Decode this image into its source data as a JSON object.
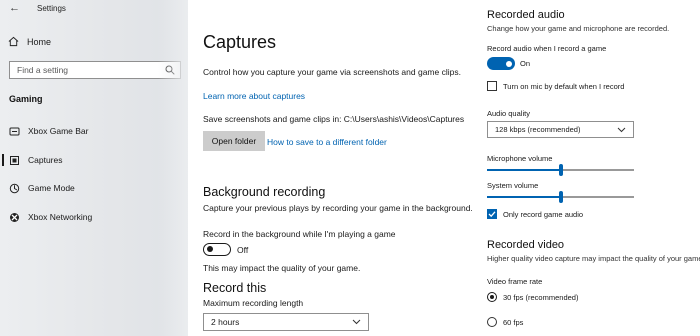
{
  "window": {
    "title": "Settings"
  },
  "sidebar": {
    "home_label": "Home",
    "search_placeholder": "Find a setting",
    "section": "Gaming",
    "items": [
      {
        "label": "Xbox Game Bar",
        "icon": "xbox-game-bar-icon"
      },
      {
        "label": "Captures",
        "icon": "captures-icon",
        "active": true
      },
      {
        "label": "Game Mode",
        "icon": "game-mode-icon"
      },
      {
        "label": "Xbox Networking",
        "icon": "xbox-icon"
      }
    ]
  },
  "main": {
    "title": "Captures",
    "description": "Control how you capture your game via screenshots and game clips.",
    "learn_more": "Learn more about captures",
    "save_path": "Save screenshots and game clips in: C:\\Users\\ashis\\Videos\\Captures",
    "open_folder": "Open folder",
    "how_to_save": "How to save to a different folder",
    "background": {
      "heading": "Background recording",
      "description": "Capture your previous plays by recording your game in the background.",
      "toggle_label": "Record in the background while I'm playing a game",
      "toggle_state": "Off",
      "note": "This may impact the quality of your game."
    },
    "record_this": {
      "heading": "Record this",
      "max_length_label": "Maximum recording length",
      "max_length_value": "2 hours"
    }
  },
  "right": {
    "audio": {
      "heading": "Recorded audio",
      "description": "Change how your game and microphone are recorded.",
      "toggle_label": "Record audio when I record a game",
      "toggle_state": "On",
      "mic_checkbox": "Turn on mic by default when I record",
      "quality_label": "Audio quality",
      "quality_value": "128 kbps (recommended)",
      "mic_volume_label": "Microphone volume",
      "mic_volume": 0.5,
      "system_volume_label": "System volume",
      "system_volume": 0.5,
      "only_game_audio": "Only record game audio"
    },
    "video": {
      "heading": "Recorded video",
      "description": "Higher quality video capture may impact the quality of your game",
      "frame_rate_label": "Video frame rate",
      "options": [
        "30 fps (recommended)",
        "60 fps"
      ]
    }
  },
  "colors": {
    "accent": "#0063b1",
    "link": "#0063b1",
    "button": "#cccccc"
  }
}
